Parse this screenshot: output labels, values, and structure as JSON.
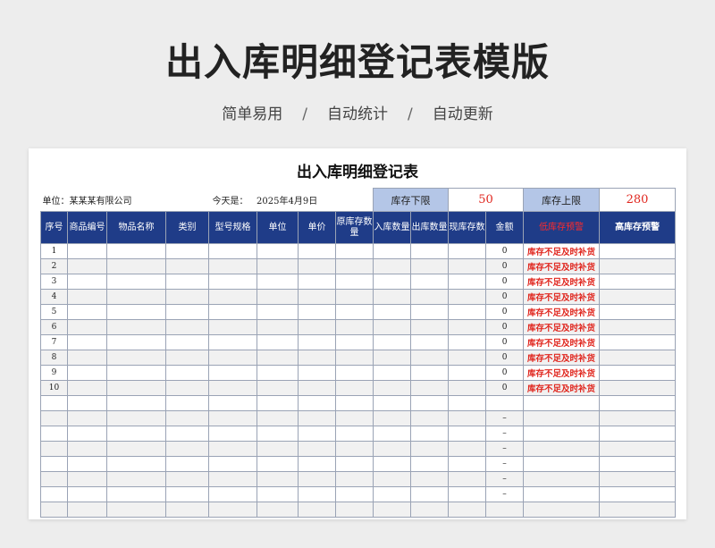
{
  "header": {
    "title": "出入库明细登记表模版",
    "features": [
      "简单易用",
      "自动统计",
      "自动更新"
    ],
    "separator": "/"
  },
  "sheet": {
    "title": "出入库明细登记表",
    "unit_label": "单位：某某某有限公司",
    "date_label": "今天是：",
    "date_value": "2025年4月9日",
    "lower_limit_label": "库存下限",
    "lower_limit_value": "50",
    "upper_limit_label": "库存上限",
    "upper_limit_value": "280",
    "columns": [
      "序号",
      "商品编号",
      "物品名称",
      "类别",
      "型号规格",
      "单位",
      "单价",
      "原库存数量",
      "入库数量",
      "出库数量",
      "现库存数",
      "金额",
      "低库存预警",
      "高库存预警"
    ],
    "rows": [
      {
        "no": "1",
        "amount": "0",
        "low": "库存不足及时补货",
        "high": ""
      },
      {
        "no": "2",
        "amount": "0",
        "low": "库存不足及时补货",
        "high": ""
      },
      {
        "no": "3",
        "amount": "0",
        "low": "库存不足及时补货",
        "high": ""
      },
      {
        "no": "4",
        "amount": "0",
        "low": "库存不足及时补货",
        "high": ""
      },
      {
        "no": "5",
        "amount": "0",
        "low": "库存不足及时补货",
        "high": ""
      },
      {
        "no": "6",
        "amount": "0",
        "low": "库存不足及时补货",
        "high": ""
      },
      {
        "no": "7",
        "amount": "0",
        "low": "库存不足及时补货",
        "high": ""
      },
      {
        "no": "8",
        "amount": "0",
        "low": "库存不足及时补货",
        "high": ""
      },
      {
        "no": "9",
        "amount": "0",
        "low": "库存不足及时补货",
        "high": ""
      },
      {
        "no": "10",
        "amount": "0",
        "low": "库存不足及时补货",
        "high": ""
      },
      {
        "no": "",
        "amount": "",
        "low": "",
        "high": ""
      },
      {
        "no": "",
        "amount": "–",
        "low": "",
        "high": ""
      },
      {
        "no": "",
        "amount": "–",
        "low": "",
        "high": ""
      },
      {
        "no": "",
        "amount": "–",
        "low": "",
        "high": ""
      },
      {
        "no": "",
        "amount": "–",
        "low": "",
        "high": ""
      },
      {
        "no": "",
        "amount": "–",
        "low": "",
        "high": ""
      },
      {
        "no": "",
        "amount": "–",
        "low": "",
        "high": ""
      },
      {
        "no": "",
        "amount": "",
        "low": "",
        "high": ""
      }
    ]
  }
}
